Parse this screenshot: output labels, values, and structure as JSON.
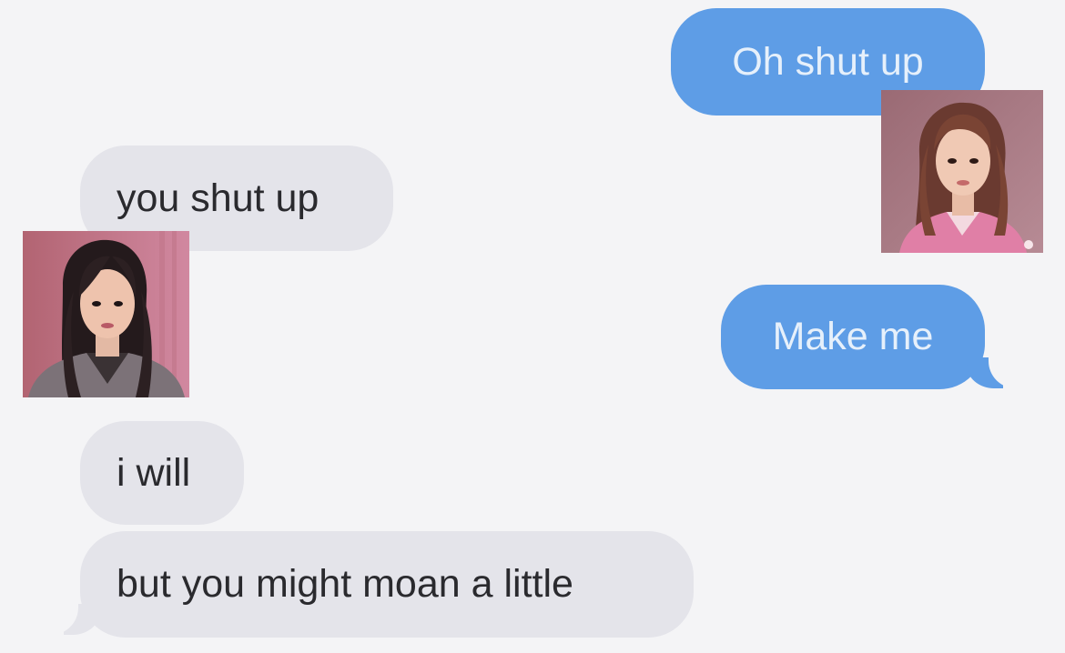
{
  "conversation": {
    "messages": [
      {
        "sender": "me",
        "text": "Oh shut up"
      },
      {
        "sender": "them",
        "text": "you shut up"
      },
      {
        "sender": "me",
        "text": "Make me"
      },
      {
        "sender": "them",
        "text": "i will"
      },
      {
        "sender": "them",
        "text": "but you might moan a little"
      }
    ]
  },
  "colors": {
    "background": "#f4f4f6",
    "outgoing_bubble": "#5e9de6",
    "outgoing_text": "#e6f0fb",
    "incoming_bubble": "#e4e4ea",
    "incoming_text": "#2a2a2e"
  },
  "avatars": {
    "right": {
      "icon": "woman-portrait-pink-jacket"
    },
    "left": {
      "icon": "woman-portrait-dark-hair"
    }
  }
}
